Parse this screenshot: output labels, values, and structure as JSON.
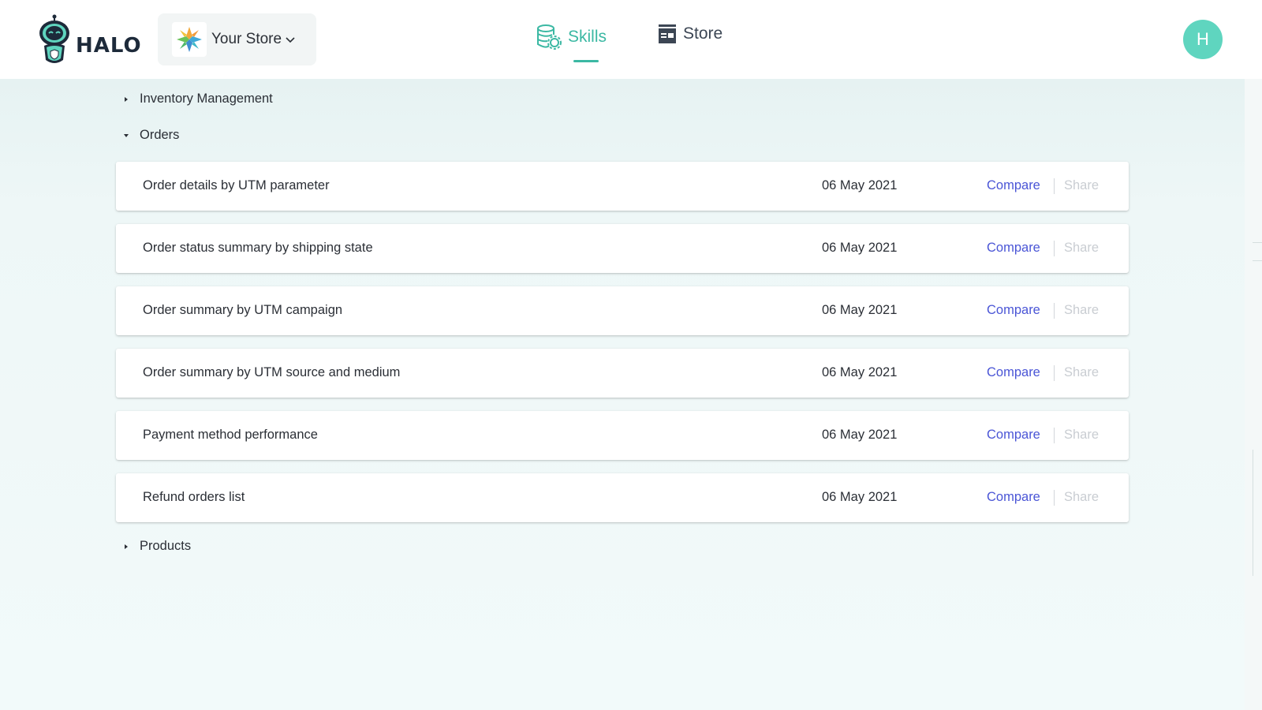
{
  "header": {
    "logo_text": "HALO",
    "store_name": "Your Store",
    "nav": [
      {
        "label": "Skills",
        "active": true
      },
      {
        "label": "Store",
        "active": false
      }
    ],
    "avatar_initial": "H"
  },
  "colors": {
    "accent": "#3bb8a3",
    "link": "#4a55d6",
    "avatar": "#5fd5bf"
  },
  "sections": [
    {
      "label": "Inventory Management",
      "expanded": false
    },
    {
      "label": "Orders",
      "expanded": true
    },
    {
      "label": "Products",
      "expanded": false
    }
  ],
  "orders": [
    {
      "title": "Order details by UTM parameter",
      "date": "06 May 2021",
      "compare": "Compare",
      "share": "Share"
    },
    {
      "title": "Order status summary by shipping state",
      "date": "06 May 2021",
      "compare": "Compare",
      "share": "Share"
    },
    {
      "title": "Order summary by UTM campaign",
      "date": "06 May 2021",
      "compare": "Compare",
      "share": "Share"
    },
    {
      "title": "Order summary by UTM source and medium",
      "date": "06 May 2021",
      "compare": "Compare",
      "share": "Share"
    },
    {
      "title": "Payment method performance",
      "date": "06 May 2021",
      "compare": "Compare",
      "share": "Share"
    },
    {
      "title": "Refund orders list",
      "date": "06 May 2021",
      "compare": "Compare",
      "share": "Share"
    }
  ]
}
